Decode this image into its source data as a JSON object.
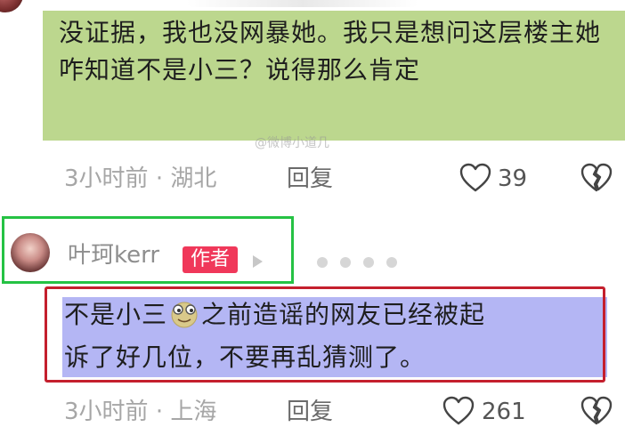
{
  "comment1": {
    "text": "没证据，我也没网暴她。我只是想问这层楼主她咋知道不是小三？说得那么肯定",
    "time": "3小时前",
    "location": "湖北",
    "reply_label": "回复",
    "likes": "39"
  },
  "watermark": "@微博小道几",
  "author_comment": {
    "name": "叶珂kerr",
    "badge": "作者",
    "text_part1": "不是小三",
    "text_part2": "之前造谣的网友已经被起",
    "text_line2": "诉了好几位，不要再乱猜测了。",
    "time": "3小时前",
    "location": "上海",
    "reply_label": "回复",
    "likes": "261"
  },
  "colors": {
    "highlight_green": "#bcd78e",
    "highlight_purple": "#b4b6f4",
    "box_green": "#25c244",
    "box_red": "#c41f2d",
    "badge_red": "#f0385a"
  }
}
